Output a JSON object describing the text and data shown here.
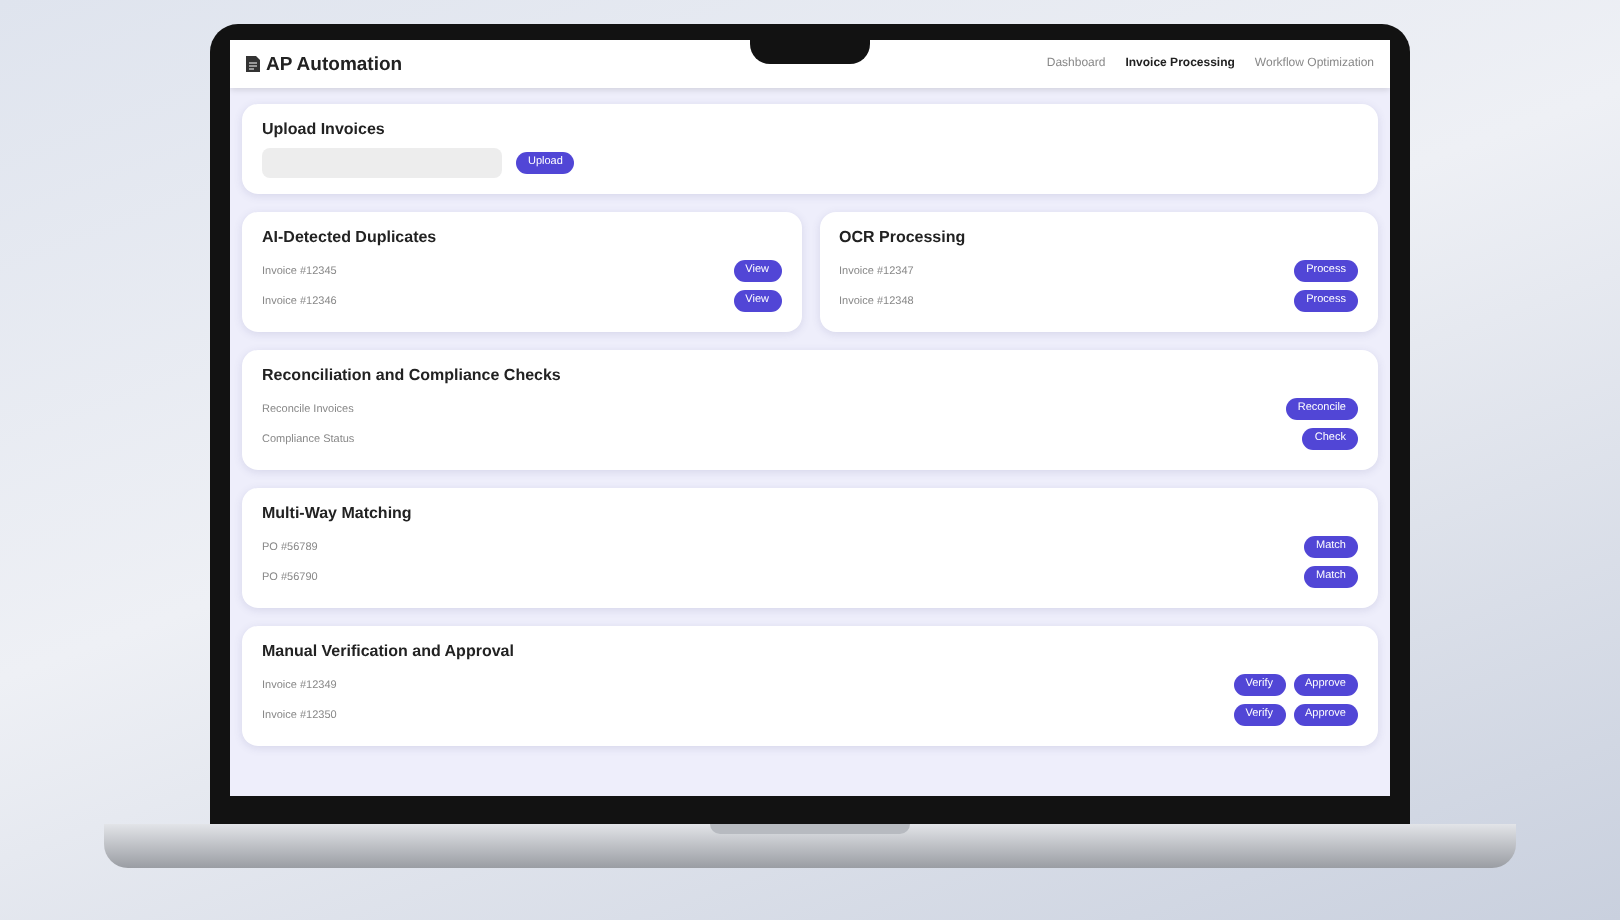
{
  "app": {
    "title": "AP Automation"
  },
  "nav": [
    {
      "label": "Dashboard",
      "selected": false
    },
    {
      "label": "Invoice Processing",
      "selected": true
    },
    {
      "label": "Workflow Optimization",
      "selected": false
    }
  ],
  "upload": {
    "title": "Upload Invoices",
    "button": "Upload"
  },
  "card_rows": [
    [
      {
        "title": "AI-Detected Duplicates",
        "rows": [
          {
            "label": "Invoice #12345",
            "buttons": [
              "View"
            ]
          },
          {
            "label": "Invoice #12346",
            "buttons": [
              "View"
            ]
          }
        ]
      },
      {
        "title": "OCR Processing",
        "rows": [
          {
            "label": "Invoice #12347",
            "buttons": [
              "Process"
            ]
          },
          {
            "label": "Invoice #12348",
            "buttons": [
              "Process"
            ]
          }
        ]
      }
    ],
    [
      {
        "title": "Reconciliation and Compliance Checks",
        "rows": [
          {
            "label": "Reconcile Invoices",
            "buttons": [
              "Reconcile"
            ]
          },
          {
            "label": "Compliance Status",
            "buttons": [
              "Check"
            ]
          }
        ]
      }
    ],
    [
      {
        "title": "Multi-Way Matching",
        "rows": [
          {
            "label": "PO #56789",
            "buttons": [
              "Match"
            ]
          },
          {
            "label": "PO #56790",
            "buttons": [
              "Match"
            ]
          }
        ]
      }
    ],
    [
      {
        "title": "Manual Verification and Approval",
        "rows": [
          {
            "label": "Invoice #12349",
            "buttons": [
              "Verify",
              "Approve"
            ]
          },
          {
            "label": "Invoice #12350",
            "buttons": [
              "Verify",
              "Approve"
            ]
          }
        ]
      }
    ]
  ]
}
